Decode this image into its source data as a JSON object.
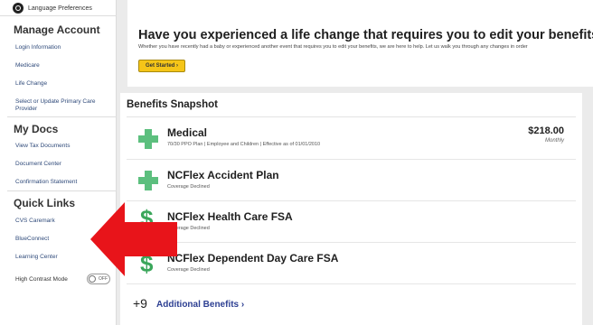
{
  "sidebar": {
    "language": "Language Preferences",
    "sections": [
      {
        "title": "Manage Account",
        "items": [
          "Login Information",
          "Medicare",
          "Life Change",
          "Select or Update Primary Care Provider"
        ]
      },
      {
        "title": "My Docs",
        "items": [
          "View Tax Documents",
          "Document Center",
          "Confirmation Statement"
        ]
      },
      {
        "title": "Quick Links",
        "items": [
          "CVS Caremark",
          "BlueConnect",
          "Learning Center"
        ]
      }
    ],
    "high_contrast": {
      "label": "High Contrast Mode",
      "state": "OFF"
    }
  },
  "life_change": {
    "title": "Have you experienced a life change that requires you to edit your benefits?",
    "subtitle": "Whether you have recently had a baby or experienced another event that requires you to edit your benefits, we are here to help. Let us walk you through any changes in order",
    "button": "Get Started ›"
  },
  "snapshot": {
    "title": "Benefits Snapshot",
    "items": [
      {
        "name": "Medical",
        "detail": "70/30 PPO Plan | Employee and Children | Effective as of 01/01/2010",
        "amount": "$218.00",
        "frequency": "Monthly"
      },
      {
        "name": "NCFlex Accident Plan",
        "detail": "Coverage Declined"
      },
      {
        "name": "NCFlex Health Care FSA",
        "detail": "Coverage Declined"
      },
      {
        "name": "NCFlex Dependent Day Care FSA",
        "detail": "Coverage Declined"
      }
    ],
    "more_count": "+9",
    "more_label": "Additional Benefits ›"
  },
  "icons": {
    "plus": "plus-cross-icon",
    "dollar": "$",
    "globe": "globe-icon",
    "arrow": "red-arrow-annotation"
  },
  "colors": {
    "green": "#5cbf7e",
    "arrow": "#e8141a",
    "button": "#f5c518",
    "link": "#2d3f92"
  }
}
